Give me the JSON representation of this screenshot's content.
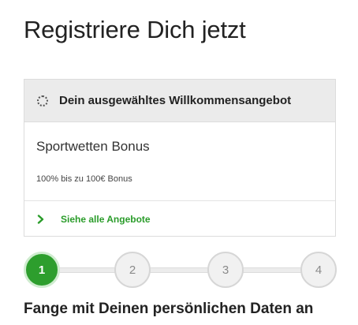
{
  "page": {
    "title": "Registriere Dich jetzt"
  },
  "offer": {
    "header": "Dein ausgewähltes Willkommensangebot",
    "name": "Sportwetten Bonus",
    "detail": "100% bis zu 100€ Bonus",
    "link_label": "Siehe alle Angebote",
    "accent_color": "#2a9c2a"
  },
  "stepper": {
    "steps": [
      "1",
      "2",
      "3",
      "4"
    ],
    "current_step": 1,
    "active_color": "#2d9e2d"
  },
  "section": {
    "heading": "Fange mit Deinen persönlichen Daten an"
  },
  "icons": {
    "offer_status": "spinner-icon",
    "link": "chevron-right-icon"
  }
}
